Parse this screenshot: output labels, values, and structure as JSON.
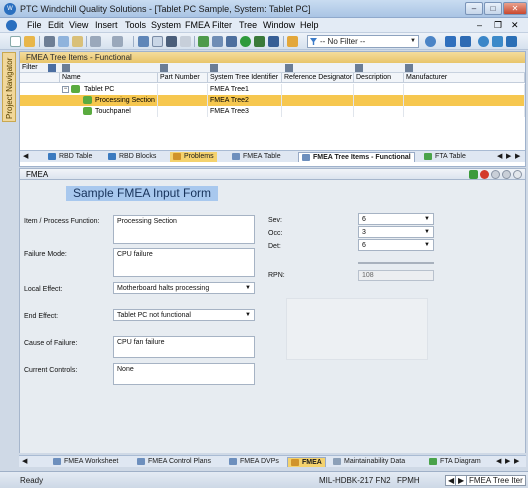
{
  "window": {
    "title": "PTC Windchill Quality Solutions - [Tablet PC Sample, System: Tablet PC]",
    "app_icon": "wqs-app-icon"
  },
  "menu": [
    "File",
    "Edit",
    "View",
    "Insert",
    "Tools",
    "System",
    "FMEA",
    "Filter",
    "Tree",
    "Window",
    "Help"
  ],
  "toolbar": {
    "filter_value": "-- No Filter --"
  },
  "navigator": {
    "label": "Project Navigator"
  },
  "top_panel": {
    "title": "FMEA Tree Items - Functional",
    "filter_label": "Filter",
    "columns": [
      "Name",
      "Part Number",
      "System Tree Identifier",
      "Reference Designator",
      "Description",
      "Manufacturer"
    ],
    "rows": [
      {
        "name": "Tablet PC",
        "part": "",
        "id": "FMEA Tree1",
        "ref": "",
        "desc": "",
        "mfr": "",
        "level": 0
      },
      {
        "name": "Processing Section",
        "part": "",
        "id": "FMEA Tree2",
        "ref": "",
        "desc": "",
        "mfr": "",
        "level": 1
      },
      {
        "name": "Touchpanel",
        "part": "",
        "id": "FMEA Tree3",
        "ref": "",
        "desc": "",
        "mfr": "",
        "level": 1
      }
    ],
    "tabs": [
      "RBD Table",
      "RBD Blocks",
      "Problems",
      "FMEA Table",
      "FMEA Tree Items - Functional",
      "FTA Table"
    ]
  },
  "fmea": {
    "panel_title": "FMEA",
    "form_title": "Sample FMEA Input Form",
    "labels": {
      "item_function": "Item / Process Function:",
      "failure_mode": "Failure Mode:",
      "local_effect": "Local Effect:",
      "end_effect": "End Effect:",
      "cause": "Cause of Failure:",
      "controls": "Current Controls:",
      "sev": "Sev:",
      "occ": "Occ:",
      "det": "Det:",
      "rpn": "RPN:"
    },
    "values": {
      "item_function": "Processing Section",
      "failure_mode": "CPU failure",
      "local_effect": "Motherboard halts processing",
      "end_effect": "Tablet PC not functional",
      "cause": "CPU fan failure",
      "controls": "None",
      "sev": "6",
      "occ": "3",
      "det": "6",
      "rpn": "108"
    },
    "tabs": [
      "FMEA Worksheet",
      "FMEA Control Plans",
      "FMEA DVPs",
      "FMEA",
      "Maintainability Data",
      "FTA Diagram"
    ]
  },
  "status": {
    "left": "Ready",
    "standard": "MIL-HDBK-217 FN2",
    "units": "FPMH",
    "current_view": "FMEA Tree Iter"
  },
  "colors": {
    "selected_row": "#f6c74f",
    "panel_header": "#e8c56a",
    "form_title_bg": "#a8c8ee"
  }
}
